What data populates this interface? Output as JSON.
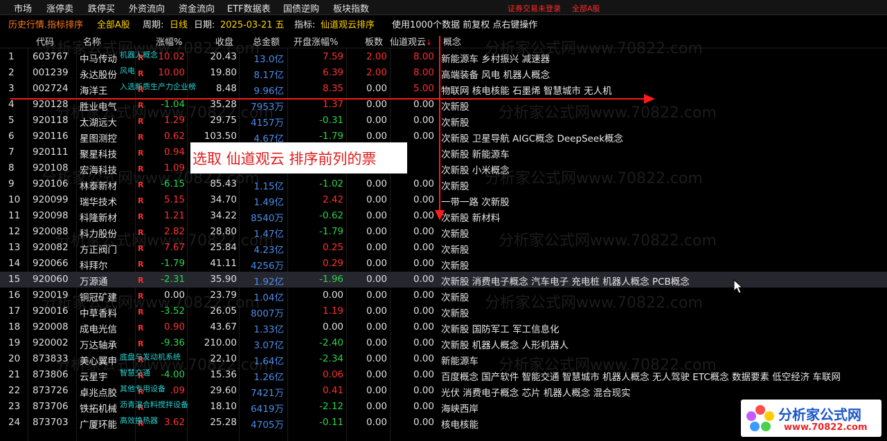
{
  "menu": [
    "市场",
    "涨停卖",
    "跌停买",
    "外资流向",
    "资金流向",
    "ETF数据表",
    "国债逆购",
    "板块指数"
  ],
  "login_status": [
    "证券交易未登录",
    "全部A股"
  ],
  "infobar": {
    "title": "历史行情.指标排序",
    "scope": "全部A股",
    "period_label": "周期:",
    "period": "日线",
    "date_label": "日期:",
    "date": "2025-03-21 五",
    "indicator_label": "指标:",
    "indicator": "仙道观云排序",
    "note": "使用1000个数据 前复权 点右键操作"
  },
  "columns": [
    "代码",
    "名称",
    "涨幅%",
    "收盘",
    "总金额",
    "开盘涨幅%",
    "板数",
    "仙道观云",
    "概念"
  ],
  "sort_arrow": "↓",
  "rows": [
    {
      "idx": "1",
      "code": "603767",
      "name": "中马传动",
      "tag": "机器人概念",
      "chg": "10.02",
      "close": "20.43",
      "amount": "13.0亿",
      "open_chg": "7.59",
      "boards": "2.00",
      "xdgy": "8.00",
      "concept": "新能源车 乡村振兴 减速器"
    },
    {
      "idx": "2",
      "code": "001239",
      "name": "永达股份",
      "tag": "风电",
      "chg": "10.00",
      "close": "19.80",
      "amount": "8.17亿",
      "open_chg": "6.39",
      "boards": "2.00",
      "xdgy": "8.00",
      "concept": "高端装备 风电 机器人概念"
    },
    {
      "idx": "3",
      "code": "002724",
      "name": "海洋王",
      "tag": "入选新质生产力企业榜",
      "chg": "",
      "close": "8.48",
      "amount": "9.96亿",
      "open_chg": "8.35",
      "boards": "0.00",
      "xdgy": "5.00",
      "concept": "物联网 核电核能 石墨烯 智慧城市 无人机"
    },
    {
      "idx": "4",
      "code": "920128",
      "name": "胜业电气",
      "tag": "",
      "chg": "-1.04",
      "close": "35.28",
      "amount": "7953万",
      "open_chg": "1.37",
      "boards": "0.00",
      "xdgy": "0.00",
      "concept": "次新股"
    },
    {
      "idx": "5",
      "code": "920118",
      "name": "太湖远大",
      "tag": "",
      "chg": "1.29",
      "close": "29.75",
      "amount": "4157万",
      "open_chg": "-0.31",
      "boards": "0.00",
      "xdgy": "0.00",
      "concept": "次新股"
    },
    {
      "idx": "6",
      "code": "920116",
      "name": "星图测控",
      "tag": "",
      "chg": "0.62",
      "close": "103.50",
      "amount": "4.67亿",
      "open_chg": "-1.79",
      "boards": "0.00",
      "xdgy": "0.00",
      "concept": "次新股 卫星导航 AIGC概念 DeepSeek概念"
    },
    {
      "idx": "7",
      "code": "920111",
      "name": "聚星科技",
      "tag": "",
      "chg": "0.94",
      "close": "",
      "amount": "",
      "open_chg": "",
      "boards": "",
      "xdgy": "",
      "concept": "次新股 新能源车"
    },
    {
      "idx": "8",
      "code": "920108",
      "name": "宏海科技",
      "tag": "",
      "chg": "1.09",
      "close": "",
      "amount": "",
      "open_chg": "",
      "boards": "",
      "xdgy": "",
      "concept": "次新股 小米概念"
    },
    {
      "idx": "9",
      "code": "920106",
      "name": "林泰新材",
      "tag": "",
      "chg": "-6.15",
      "close": "85.43",
      "amount": "1.15亿",
      "open_chg": "-1.02",
      "boards": "0.00",
      "xdgy": "0.00",
      "concept": "次新股"
    },
    {
      "idx": "10",
      "code": "920099",
      "name": "瑞华技术",
      "tag": "",
      "chg": "5.15",
      "close": "34.70",
      "amount": "1.49亿",
      "open_chg": "2.42",
      "boards": "0.00",
      "xdgy": "0.00",
      "concept": "一带一路 次新股"
    },
    {
      "idx": "11",
      "code": "920098",
      "name": "科隆新材",
      "tag": "",
      "chg": "1.21",
      "close": "34.22",
      "amount": "8540万",
      "open_chg": "-0.62",
      "boards": "0.00",
      "xdgy": "0.00",
      "concept": "次新股 新材料"
    },
    {
      "idx": "12",
      "code": "920088",
      "name": "科力股份",
      "tag": "",
      "chg": "2.82",
      "close": "28.80",
      "amount": "1.47亿",
      "open_chg": "-1.79",
      "boards": "0.00",
      "xdgy": "0.00",
      "concept": "次新股"
    },
    {
      "idx": "13",
      "code": "920082",
      "name": "方正阀门",
      "tag": "",
      "chg": "7.67",
      "close": "25.84",
      "amount": "4.23亿",
      "open_chg": "0.25",
      "boards": "0.00",
      "xdgy": "0.00",
      "concept": "次新股"
    },
    {
      "idx": "14",
      "code": "920066",
      "name": "科拜尔",
      "tag": "",
      "chg": "-1.79",
      "close": "41.11",
      "amount": "4256万",
      "open_chg": "0.29",
      "boards": "0.00",
      "xdgy": "0.00",
      "concept": "次新股"
    },
    {
      "idx": "15",
      "code": "920060",
      "name": "万源通",
      "tag": "",
      "chg": "-2.31",
      "close": "35.90",
      "amount": "1.92亿",
      "open_chg": "-1.96",
      "boards": "0.00",
      "xdgy": "0.00",
      "concept": "次新股 消费电子概念 汽车电子 充电桩 机器人概念 PCB概念"
    },
    {
      "idx": "16",
      "code": "920019",
      "name": "铜冠矿建",
      "tag": "",
      "chg": "0.00",
      "close": "23.79",
      "amount": "1.04亿",
      "open_chg": "0.00",
      "boards": "0.00",
      "xdgy": "0.00",
      "concept": "次新股"
    },
    {
      "idx": "17",
      "code": "920016",
      "name": "中草香料",
      "tag": "",
      "chg": "-3.52",
      "close": "26.05",
      "amount": "8007万",
      "open_chg": "1.19",
      "boards": "0.00",
      "xdgy": "0.00",
      "concept": "次新股"
    },
    {
      "idx": "18",
      "code": "920008",
      "name": "成电光信",
      "tag": "",
      "chg": "0.90",
      "close": "43.67",
      "amount": "1.33亿",
      "open_chg": "0.00",
      "boards": "0.00",
      "xdgy": "0.00",
      "concept": "次新股 国防军工 军工信息化"
    },
    {
      "idx": "19",
      "code": "920002",
      "name": "万达轴承",
      "tag": "",
      "chg": "-9.36",
      "close": "210.00",
      "amount": "3.07亿",
      "open_chg": "-2.40",
      "boards": "0.00",
      "xdgy": "0.00",
      "concept": "次新股 机器人概念 人形机器人"
    },
    {
      "idx": "20",
      "code": "873833",
      "name": "美心翼申",
      "tag": "底盘与发动机系统",
      "chg": "",
      "close": "22.10",
      "amount": "1.64亿",
      "open_chg": "-2.34",
      "boards": "0.00",
      "xdgy": "0.00",
      "concept": "新能源车"
    },
    {
      "idx": "21",
      "code": "873806",
      "name": "云星宇",
      "tag": "智慧交通",
      "chg": "-4.00",
      "close": "15.36",
      "amount": "1.26亿",
      "open_chg": "0.06",
      "boards": "0.00",
      "xdgy": "0.00",
      "concept": "百度概念 国产软件 智能交通 智慧城市 机器人概念 无人驾驶 ETC概念 数据要素 低空经济 车联网"
    },
    {
      "idx": "22",
      "code": "873726",
      "name": "卓兆点胶",
      "tag": "其他专用设备",
      "chg": ".09",
      "close": "29.60",
      "amount": "7421万",
      "open_chg": "0.41",
      "boards": "0.00",
      "xdgy": "0.00",
      "concept": "光伏 消费电子概念 芯片 机器人概念 混合现实"
    },
    {
      "idx": "23",
      "code": "873706",
      "name": "铁拓机械",
      "tag": "沥青混合料搅拌设备",
      "chg": "",
      "close": "18.10",
      "amount": "6419万",
      "open_chg": "-2.12",
      "boards": "0.00",
      "xdgy": "0.00",
      "concept": "海峡西岸"
    },
    {
      "idx": "24",
      "code": "873703",
      "name": "广厦环能",
      "tag": "高效换热器",
      "chg": "3.62",
      "close": "25.28",
      "amount": "4705万",
      "open_chg": "-0.11",
      "boards": "0.00",
      "xdgy": "0.00",
      "concept": "核电核能"
    }
  ],
  "annotation": "选取 仙道观云 排序前列的票",
  "watermark": "分析家公式网www.70822.com",
  "logo": {
    "title": "分析家公式网",
    "url": "www.70822.com"
  },
  "colors": {
    "up": "#ff3030",
    "down": "#2cd44a",
    "amount": "#4a8eea",
    "arrow": "#ff1a1a",
    "tag": "#29d1d1",
    "title": "#ff7a1a",
    "highlight": "#ffd200"
  }
}
